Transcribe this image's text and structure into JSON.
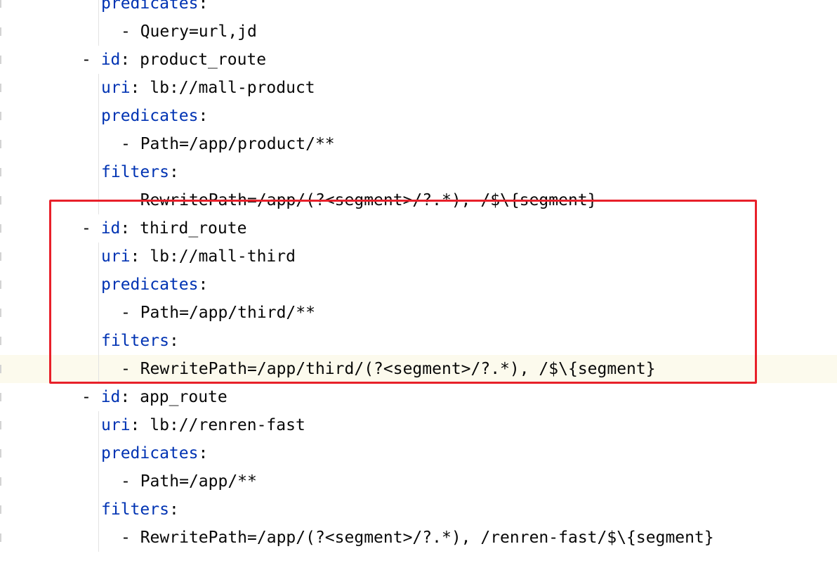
{
  "editor": {
    "lines": [
      {
        "indent": 4,
        "dash": false,
        "key": "predicates",
        "sep": ":",
        "value": "",
        "current": false
      },
      {
        "indent": 5,
        "dash": true,
        "key": "",
        "sep": "",
        "value": "Query=url,jd",
        "current": false
      },
      {
        "indent": 3,
        "dash": true,
        "key": "id",
        "sep": ": ",
        "value": "product_route",
        "current": false
      },
      {
        "indent": 4,
        "dash": false,
        "key": "uri",
        "sep": ": ",
        "value": "lb://mall-product",
        "current": false
      },
      {
        "indent": 4,
        "dash": false,
        "key": "predicates",
        "sep": ":",
        "value": "",
        "current": false
      },
      {
        "indent": 5,
        "dash": true,
        "key": "",
        "sep": "",
        "value": "Path=/app/product/**",
        "current": false
      },
      {
        "indent": 4,
        "dash": false,
        "key": "filters",
        "sep": ":",
        "value": "",
        "current": false
      },
      {
        "indent": 5,
        "dash": true,
        "key": "",
        "sep": "",
        "value": "RewritePath=/app/(?<segment>/?.*), /$\\{segment}",
        "current": false
      },
      {
        "indent": 3,
        "dash": true,
        "key": "id",
        "sep": ": ",
        "value": "third_route",
        "current": false
      },
      {
        "indent": 4,
        "dash": false,
        "key": "uri",
        "sep": ": ",
        "value": "lb://mall-third",
        "current": false
      },
      {
        "indent": 4,
        "dash": false,
        "key": "predicates",
        "sep": ":",
        "value": "",
        "current": false
      },
      {
        "indent": 5,
        "dash": true,
        "key": "",
        "sep": "",
        "value": "Path=/app/third/**",
        "current": false
      },
      {
        "indent": 4,
        "dash": false,
        "key": "filters",
        "sep": ":",
        "value": "",
        "current": false
      },
      {
        "indent": 5,
        "dash": true,
        "key": "",
        "sep": "",
        "value": "RewritePath=/app/third/(?<segment>/?.*), /$\\{segment}",
        "current": true
      },
      {
        "indent": 3,
        "dash": true,
        "key": "id",
        "sep": ": ",
        "value": "app_route",
        "current": false
      },
      {
        "indent": 4,
        "dash": false,
        "key": "uri",
        "sep": ": ",
        "value": "lb://renren-fast",
        "current": false
      },
      {
        "indent": 4,
        "dash": false,
        "key": "predicates",
        "sep": ":",
        "value": "",
        "current": false
      },
      {
        "indent": 5,
        "dash": true,
        "key": "",
        "sep": "",
        "value": "Path=/app/**",
        "current": false
      },
      {
        "indent": 4,
        "dash": false,
        "key": "filters",
        "sep": ":",
        "value": "",
        "current": false
      },
      {
        "indent": 5,
        "dash": true,
        "key": "",
        "sep": "",
        "value": "RewritePath=/app/(?<segment>/?.*), /renren-fast/$\\{segment}",
        "current": false
      }
    ]
  },
  "annotation": {
    "color": "#e8202a"
  }
}
